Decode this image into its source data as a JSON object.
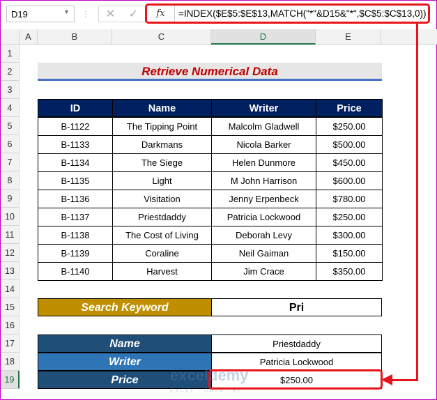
{
  "formula_bar": {
    "name_box": "D19",
    "cancel_icon": "✕",
    "enter_icon": "✓",
    "fx_label": "fx",
    "formula": "=INDEX($E$5:$E$13,MATCH(\"*\"&D15&\"*\",$C$5:$C$13,0))"
  },
  "columns": [
    "A",
    "B",
    "C",
    "D",
    "E"
  ],
  "rows": [
    "1",
    "2",
    "3",
    "4",
    "5",
    "6",
    "7",
    "8",
    "9",
    "10",
    "11",
    "12",
    "13",
    "14",
    "15",
    "16",
    "17",
    "18",
    "19"
  ],
  "title": "Retrieve Numerical Data",
  "table": {
    "headers": [
      "ID",
      "Name",
      "Writer",
      "Price"
    ],
    "rows": [
      [
        "B-1122",
        "The Tipping Point",
        "Malcolm Gladwell",
        "$250.00"
      ],
      [
        "B-1133",
        "Darkmans",
        "Nicola Barker",
        "$500.00"
      ],
      [
        "B-1134",
        "The Siege",
        "Helen Dunmore",
        "$450.00"
      ],
      [
        "B-1135",
        "Light",
        "M John Harrison",
        "$600.00"
      ],
      [
        "B-1136",
        "Visitation",
        "Jenny Erpenbeck",
        "$780.00"
      ],
      [
        "B-1137",
        "Priestdaddy",
        "Patricia Lockwood",
        "$250.00"
      ],
      [
        "B-1138",
        "The Cost of Living",
        "Deborah Levy",
        "$300.00"
      ],
      [
        "B-1139",
        "Coraline",
        "Neil Gaiman",
        "$150.00"
      ],
      [
        "B-1140",
        "Harvest",
        "Jim Crace",
        "$350.00"
      ]
    ]
  },
  "search": {
    "label": "Search Keyword",
    "value": "Pri"
  },
  "result": {
    "name_label": "Name",
    "name_value": "Priestdaddy",
    "writer_label": "Writer",
    "writer_value": "Patricia Lockwood",
    "price_label": "Price",
    "price_value": "$250.00"
  },
  "watermark": {
    "brand": "exceldemy",
    "tagline": "EXCEL · DATA · BI"
  },
  "colors": {
    "header": "#002060",
    "search": "#BF8F00",
    "dark_blue": "#1F4E79",
    "mid_blue": "#2E75B6",
    "title": "#C00000",
    "highlight": "#E8141B"
  }
}
